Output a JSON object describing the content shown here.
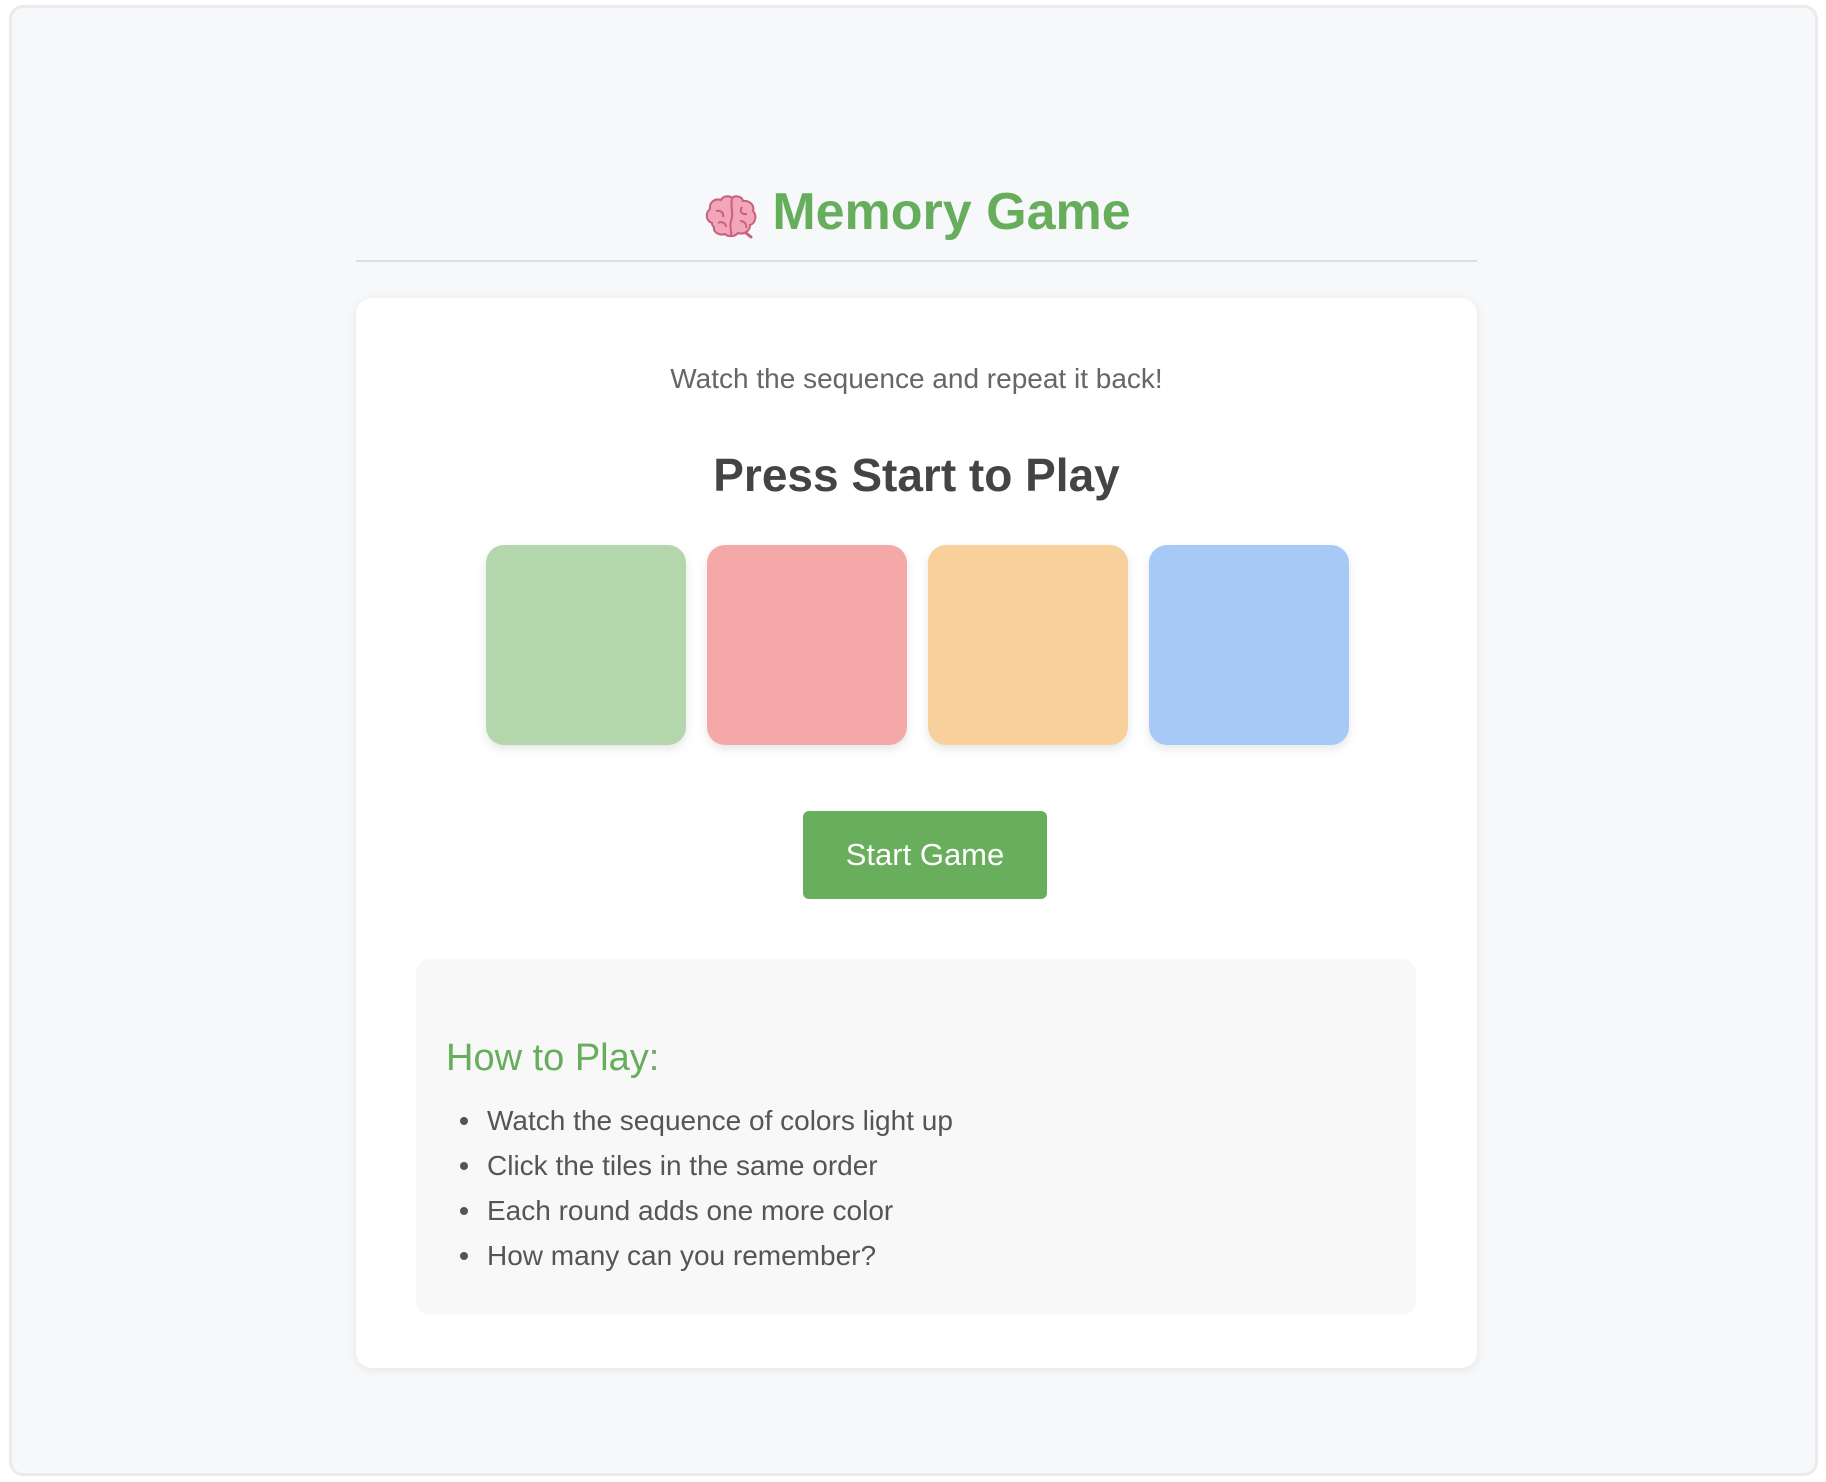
{
  "header": {
    "icon": "brain-icon",
    "title": "Memory Game"
  },
  "game": {
    "subtitle": "Watch the sequence and repeat it back!",
    "status": "Press Start to Play",
    "tiles": [
      {
        "color_name": "green",
        "color": "#b4d6ad"
      },
      {
        "color_name": "red",
        "color": "#f4a9a8"
      },
      {
        "color_name": "orange",
        "color": "#f7d09c"
      },
      {
        "color_name": "blue",
        "color": "#a7c9f5"
      }
    ],
    "start_label": "Start Game",
    "accent_color": "#68ae5d"
  },
  "howto": {
    "title": "How to Play:",
    "items": [
      "Watch the sequence of colors light up",
      "Click the tiles in the same order",
      "Each round adds one more color",
      "How many can you remember?"
    ]
  }
}
